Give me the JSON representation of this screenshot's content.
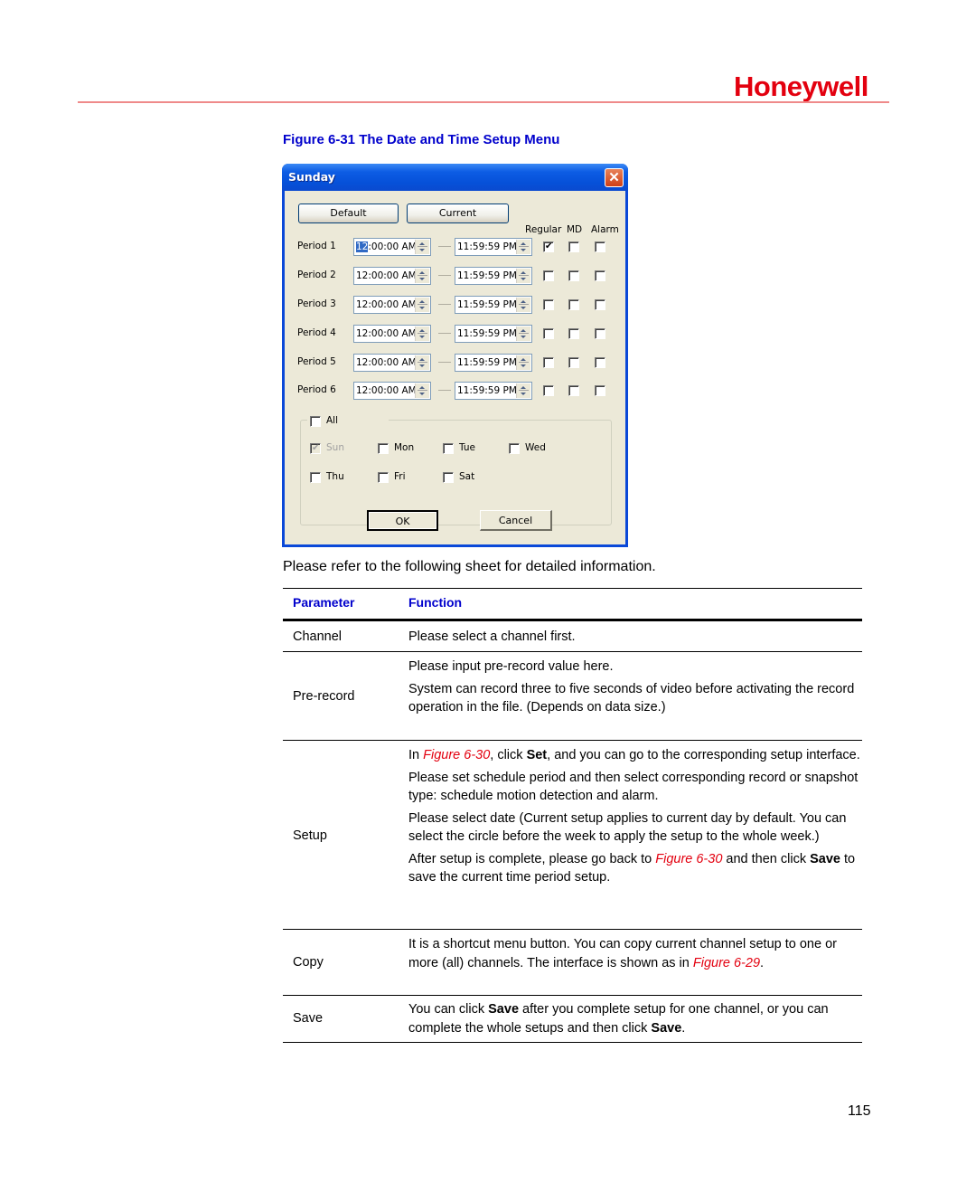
{
  "header": {
    "brand": "Honeywell"
  },
  "figure": {
    "caption": "Figure 6-31 The Date and Time Setup Menu"
  },
  "dialog": {
    "title": "Sunday",
    "buttons": {
      "default": "Default",
      "current": "Current",
      "ok": "OK",
      "cancel": "Cancel"
    },
    "column_headers": {
      "regular": "Regular",
      "md": "MD",
      "alarm": "Alarm"
    },
    "periods": [
      {
        "label": "Period 1",
        "start": "12:00:00 AM",
        "start_selected": "12",
        "start_rest": ":00:00 AM",
        "end": "11:59:59 PM",
        "regular": true,
        "md": false,
        "alarm": false
      },
      {
        "label": "Period 2",
        "start": "12:00:00 AM",
        "end": "11:59:59 PM",
        "regular": false,
        "md": false,
        "alarm": false
      },
      {
        "label": "Period 3",
        "start": "12:00:00 AM",
        "end": "11:59:59 PM",
        "regular": false,
        "md": false,
        "alarm": false
      },
      {
        "label": "Period 4",
        "start": "12:00:00 AM",
        "end": "11:59:59 PM",
        "regular": false,
        "md": false,
        "alarm": false
      },
      {
        "label": "Period 5",
        "start": "12:00:00 AM",
        "end": "11:59:59 PM",
        "regular": false,
        "md": false,
        "alarm": false
      },
      {
        "label": "Period 6",
        "start": "12:00:00 AM",
        "end": "11:59:59 PM",
        "regular": false,
        "md": false,
        "alarm": false
      }
    ],
    "days": {
      "all": {
        "label": "All",
        "checked": false
      },
      "items": [
        {
          "label": "Sun",
          "checked": true,
          "disabled": true
        },
        {
          "label": "Mon",
          "checked": false
        },
        {
          "label": "Tue",
          "checked": false
        },
        {
          "label": "Wed",
          "checked": false
        },
        {
          "label": "Thu",
          "checked": false
        },
        {
          "label": "Fri",
          "checked": false
        },
        {
          "label": "Sat",
          "checked": false
        }
      ]
    }
  },
  "intro": "Please refer to the following sheet for detailed information.",
  "table": {
    "headers": {
      "parameter": "Parameter",
      "function": "Function"
    },
    "rows": {
      "channel": {
        "param": "Channel",
        "text": "Please select a channel first."
      },
      "prerecord": {
        "param": "Pre-record",
        "p1": "Please input pre-record value here.",
        "p2": "System can record three to five seconds of video before activating the record operation in the file. (Depends on data size.)"
      },
      "setup": {
        "param": "Setup",
        "p1_a": "In ",
        "p1_ref": "Figure 6-30",
        "p1_b": ", click ",
        "p1_bold": "Set",
        "p1_c": ", and you can go to the corresponding setup interface.",
        "p2": "Please set schedule period and then select corresponding record or snapshot type: schedule motion detection and alarm.",
        "p3": "Please select date (Current setup applies to current day by default. You can select the circle before the week to apply the setup to the whole week.)",
        "p4_a": "After setup is complete, please go back to ",
        "p4_ref": "Figure 6-30",
        "p4_b": " and then click ",
        "p4_bold": "Save",
        "p4_c": " to save the current time period setup."
      },
      "copy": {
        "param": "Copy",
        "text_a": "It is a shortcut menu button. You can copy current channel setup to one or more (all) channels.  The interface is shown as in ",
        "ref": "Figure 6-29",
        "text_b": "."
      },
      "save": {
        "param": "Save",
        "a": "You can click ",
        "bold1": "Save",
        "b": " after you complete setup for one channel, or you can complete the whole setups and then click ",
        "bold2": "Save",
        "c": "."
      }
    }
  },
  "page_number": "115",
  "colors": {
    "brand_red": "#e3000f",
    "heading_blue": "#0000cc",
    "xp_title_blue": "#0a48d8",
    "dialog_bg": "#ece9d8"
  }
}
